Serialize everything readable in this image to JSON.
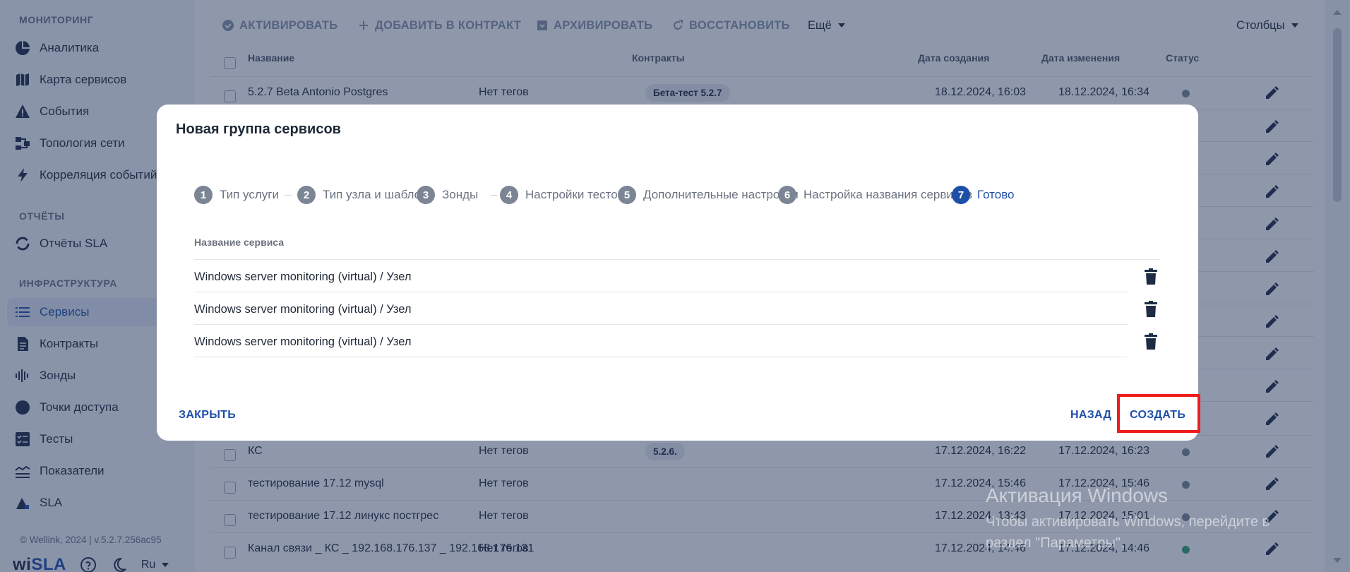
{
  "sidebar": {
    "section_monitoring": "МОНИТОРИНГ",
    "section_reports": "ОТЧЁТЫ",
    "section_infrastructure": "ИНФРАСТРУКТУРА",
    "items": [
      {
        "label": "Аналитика",
        "icon": "pie-chart-icon"
      },
      {
        "label": "Карта сервисов",
        "icon": "map-icon"
      },
      {
        "label": "События",
        "icon": "warning-icon"
      },
      {
        "label": "Топология сети",
        "icon": "topology-icon"
      },
      {
        "label": "Корреляция событий",
        "icon": "bolt-icon"
      },
      {
        "label": "Отчёты SLA",
        "icon": "circle-arrows-icon"
      },
      {
        "label": "Сервисы",
        "icon": "list-icon"
      },
      {
        "label": "Контракты",
        "icon": "document-icon"
      },
      {
        "label": "Зонды",
        "icon": "probe-icon"
      },
      {
        "label": "Точки доступа",
        "icon": "access-point-icon"
      },
      {
        "label": "Тесты",
        "icon": "checklist-icon"
      },
      {
        "label": "Показатели",
        "icon": "metrics-icon"
      },
      {
        "label": "SLA",
        "icon": "sla-icon"
      }
    ],
    "footer": "© Wellink, 2024 | v.5.2.7.256ac95",
    "logo_prefix": "wi",
    "logo_suffix": "SLA",
    "language": "Ru"
  },
  "toolbar": {
    "activate": "АКТИВИРОВАТЬ",
    "add_contract": "ДОБАВИТЬ В КОНТРАКТ",
    "archive": "АРХИВИРОВАТЬ",
    "restore": "ВОССТАНОВИТЬ",
    "more": "Ещё",
    "columns": "Столбцы"
  },
  "table": {
    "headers": {
      "name": "Название",
      "contracts": "Контракты",
      "created": "Дата создания",
      "modified": "Дата изменения",
      "status": "Статус"
    },
    "rows": [
      {
        "name": "5.2.7 Beta Antonio Postgres",
        "tags": "Нет тегов",
        "contract": "Бета-тест 5.2.7",
        "created": "18.12.2024, 16:03",
        "modified": "18.12.2024, 16:34",
        "status": "gray"
      },
      {
        "name": "КС",
        "tags": "Нет тегов",
        "contract": "5.2.6.",
        "created": "17.12.2024, 16:22",
        "modified": "17.12.2024, 16:23",
        "status": "gray"
      },
      {
        "name": "тестирование 17.12 mysql",
        "tags": "Нет тегов",
        "contract": "",
        "created": "17.12.2024, 15:46",
        "modified": "17.12.2024, 15:46",
        "status": "gray"
      },
      {
        "name": "тестирование 17.12 линукс постгрес",
        "tags": "Нет тегов",
        "contract": "",
        "created": "17.12.2024, 13:43",
        "modified": "17.12.2024, 15:01",
        "status": "gray"
      },
      {
        "name": "Канал связи _ КС _ 192.168.176.137 _ 192.168.176.131",
        "tags": "Нет тегов",
        "contract": "",
        "created": "17.12.2024, 14:46",
        "modified": "17.12.2024, 14:46",
        "status": "green"
      }
    ]
  },
  "modal": {
    "title": "Новая группа сервисов",
    "steps": [
      {
        "num": "1",
        "label": "Тип услуги"
      },
      {
        "num": "2",
        "label": "Тип узла и шаблон"
      },
      {
        "num": "3",
        "label": "Зонды"
      },
      {
        "num": "4",
        "label": "Настройки тестов"
      },
      {
        "num": "5",
        "label": "Дополнительные настройки"
      },
      {
        "num": "6",
        "label": "Настройка названия сервисов"
      },
      {
        "num": "7",
        "label": "Готово"
      }
    ],
    "active_step": 7,
    "column_header": "Название сервиса",
    "services": [
      "Windows server monitoring (virtual) / Узел",
      "Windows server monitoring (virtual) / Узел",
      "Windows server monitoring (virtual) / Узел"
    ],
    "close_label": "ЗАКРЫТЬ",
    "back_label": "НАЗАД",
    "create_label": "СОЗДАТЬ"
  },
  "watermark": {
    "line1": "Активация Windows",
    "line2": "Чтобы активировать Windows, перейдите в",
    "line3": "раздел \"Параметры\"."
  },
  "colors": {
    "accent": "#1e4fa8",
    "highlight": "#ee1d1d",
    "status_gray": "#7b8594",
    "status_green": "#2ea36a"
  }
}
